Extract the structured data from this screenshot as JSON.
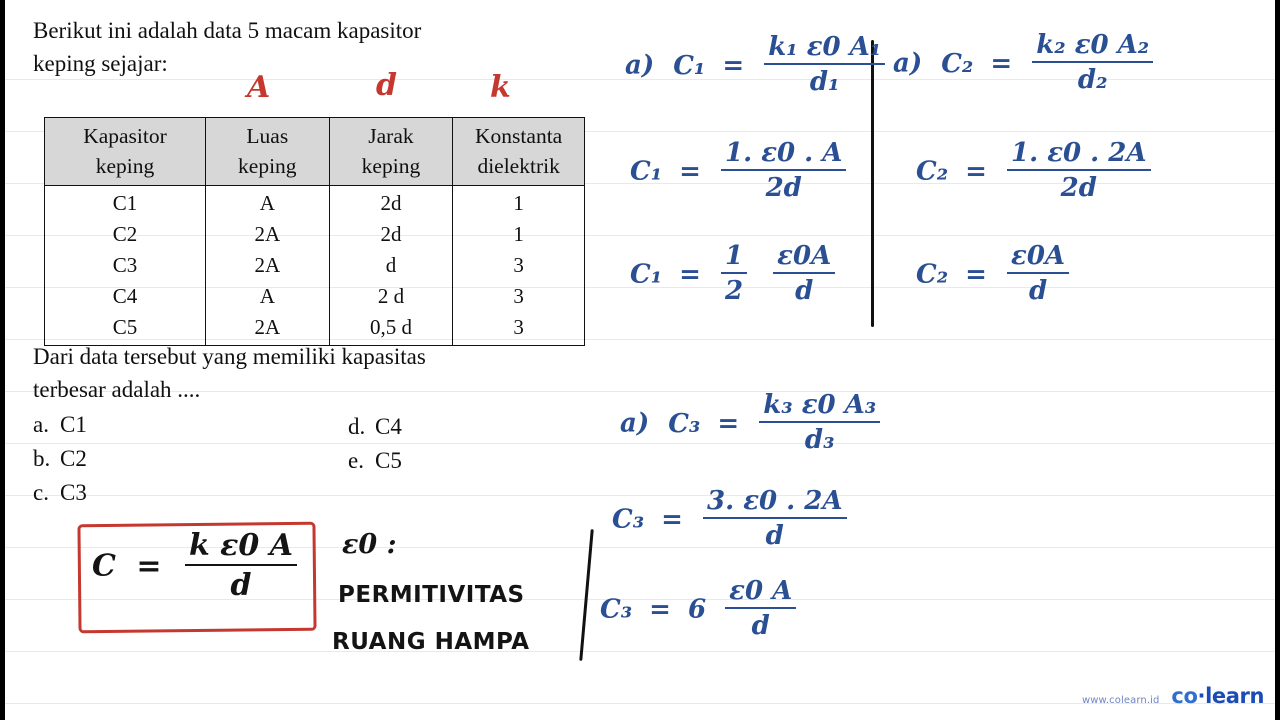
{
  "question": {
    "intro_line1": "Berikut ini adalah data 5 macam kapasitor",
    "intro_line2": "keping sejajar:",
    "ask_line1": "Dari data tersebut yang memiliki kapasitas",
    "ask_line2": "terbesar adalah ...."
  },
  "table": {
    "headers": [
      {
        "top": "Kapasitor",
        "bottom": "keping"
      },
      {
        "top": "Luas",
        "bottom": "keping"
      },
      {
        "top": "Jarak",
        "bottom": "keping"
      },
      {
        "top": "Konstanta",
        "bottom": "dielektrik"
      }
    ],
    "rows": [
      [
        "C1",
        "A",
        "2d",
        "1"
      ],
      [
        "C2",
        "2A",
        "2d",
        "1"
      ],
      [
        "C3",
        "2A",
        "d",
        "3"
      ],
      [
        "C4",
        "A",
        "2 d",
        "3"
      ],
      [
        "C5",
        "2A",
        "0,5 d",
        "3"
      ]
    ]
  },
  "column_tags": {
    "area": "A",
    "distance": "d",
    "constant": "k"
  },
  "options": [
    {
      "label": "a.",
      "text": "C1"
    },
    {
      "label": "b.",
      "text": "C2"
    },
    {
      "label": "c.",
      "text": "C3"
    },
    {
      "label": "d.",
      "text": "C4"
    },
    {
      "label": "e.",
      "text": "C5"
    }
  ],
  "boxed_formula": {
    "lhs": "C",
    "equals": "=",
    "numerator": "k ε0 A",
    "denominator": "d"
  },
  "epsilon_note": {
    "symbol": "ε0 :",
    "line1": "PERMITIVITAS",
    "line2": "RUANG HAMPA"
  },
  "work": {
    "c1": {
      "marker": "a)",
      "step1": {
        "lhs": "C₁",
        "num": "k₁ ε0 A₁",
        "den": "d₁"
      },
      "step2": {
        "lhs": "C₁",
        "num": "1. ε0 . A",
        "den": "2d"
      },
      "step3": {
        "lhs": "C₁",
        "frac1_num": "1",
        "frac1_den": "2",
        "frac2_num": "ε0A",
        "frac2_den": "d"
      }
    },
    "c2": {
      "marker": "a)",
      "step1": {
        "lhs": "C₂",
        "num": "k₂ ε0 A₂",
        "den": "d₂"
      },
      "step2": {
        "lhs": "C₂",
        "num": "1. ε0 . 2A",
        "den": "2d"
      },
      "step3": {
        "lhs": "C₂",
        "num": "ε0A",
        "den": "d"
      }
    },
    "c3": {
      "marker": "a)",
      "step1": {
        "lhs": "C₃",
        "num": "k₃ ε0 A₃",
        "den": "d₃"
      },
      "step2": {
        "lhs": "C₃",
        "num": "3. ε0 . 2A",
        "den": "d"
      },
      "step3": {
        "lhs": "C₃",
        "coef": "6",
        "num": "ε0 A",
        "den": "d"
      }
    }
  },
  "watermark": {
    "url": "www.colearn.id",
    "brand_first": "co",
    "brand_dot": "·",
    "brand_second": "learn"
  },
  "colors": {
    "red_ink": "#c5382f",
    "blue_ink": "#2a4f93",
    "black_ink": "#141414",
    "rule_line": "#e9e9ec",
    "header_fill": "#d7d7d7"
  }
}
